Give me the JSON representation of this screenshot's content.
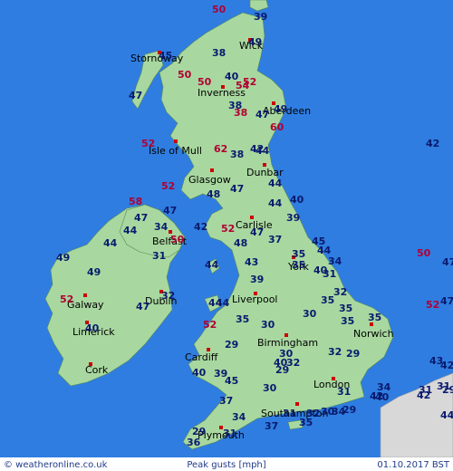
{
  "map": {
    "colors": {
      "sea": "#2f7de1",
      "land": "#a8d8a0",
      "land_stroke": "#5a8a55",
      "foreign_land": "#d8d8d8",
      "footer_bg": "#ffffff",
      "city_marker": "#cc0000",
      "normal_value": "#0a1a6e",
      "high_value": "#b00032"
    },
    "cities": [
      {
        "id": "wick",
        "label": "Wick"
      },
      {
        "id": "stornoway",
        "label": "Stornoway"
      },
      {
        "id": "inverness",
        "label": "Inverness"
      },
      {
        "id": "aberdeen",
        "label": "Aberdeen"
      },
      {
        "id": "isle-of-mull",
        "label": "Isle of Mull"
      },
      {
        "id": "dunbar",
        "label": "Dunbar"
      },
      {
        "id": "glasgow",
        "label": "Glasgow"
      },
      {
        "id": "carlisle",
        "label": "Carlisle"
      },
      {
        "id": "belfast",
        "label": "Belfast"
      },
      {
        "id": "york",
        "label": "York"
      },
      {
        "id": "dublin",
        "label": "Dublin"
      },
      {
        "id": "liverpool",
        "label": "Liverpool"
      },
      {
        "id": "galway",
        "label": "Galway"
      },
      {
        "id": "limerick",
        "label": "Limerick"
      },
      {
        "id": "birmingham",
        "label": "Birmingham"
      },
      {
        "id": "norwich",
        "label": "Norwich"
      },
      {
        "id": "cork",
        "label": "Cork"
      },
      {
        "id": "cardiff",
        "label": "Cardiff"
      },
      {
        "id": "london",
        "label": "London"
      },
      {
        "id": "southampton",
        "label": "Southampton"
      },
      {
        "id": "plymouth",
        "label": "Plymouth"
      }
    ],
    "gust_values": [
      {
        "v": "50",
        "high": true
      },
      {
        "v": "39",
        "high": false
      },
      {
        "v": "49",
        "high": false
      },
      {
        "v": "45",
        "high": false
      },
      {
        "v": "38",
        "high": false
      },
      {
        "v": "50",
        "high": true
      },
      {
        "v": "40",
        "high": false
      },
      {
        "v": "50",
        "high": true
      },
      {
        "v": "54",
        "high": true
      },
      {
        "v": "52",
        "high": true
      },
      {
        "v": "47",
        "high": false
      },
      {
        "v": "38",
        "high": false
      },
      {
        "v": "38",
        "high": true
      },
      {
        "v": "47",
        "high": false
      },
      {
        "v": "49",
        "high": false
      },
      {
        "v": "60",
        "high": true
      },
      {
        "v": "52",
        "high": true
      },
      {
        "v": "62",
        "high": true
      },
      {
        "v": "42",
        "high": false
      },
      {
        "v": "44",
        "high": false
      },
      {
        "v": "38",
        "high": false
      },
      {
        "v": "42",
        "high": false
      },
      {
        "v": "52",
        "high": true
      },
      {
        "v": "48",
        "high": false
      },
      {
        "v": "47",
        "high": false
      },
      {
        "v": "44",
        "high": false
      },
      {
        "v": "40",
        "high": false
      },
      {
        "v": "58",
        "high": true
      },
      {
        "v": "47",
        "high": false
      },
      {
        "v": "47",
        "high": false
      },
      {
        "v": "44",
        "high": false
      },
      {
        "v": "39",
        "high": false
      },
      {
        "v": "52",
        "high": true
      },
      {
        "v": "34",
        "high": false
      },
      {
        "v": "42",
        "high": false
      },
      {
        "v": "50",
        "high": true
      },
      {
        "v": "44",
        "high": false
      },
      {
        "v": "44",
        "high": false
      },
      {
        "v": "47",
        "high": false
      },
      {
        "v": "48",
        "high": false
      },
      {
        "v": "37",
        "high": false
      },
      {
        "v": "35",
        "high": false
      },
      {
        "v": "45",
        "high": false
      },
      {
        "v": "44",
        "high": false
      },
      {
        "v": "34",
        "high": false
      },
      {
        "v": "49",
        "high": false
      },
      {
        "v": "31",
        "high": false
      },
      {
        "v": "44",
        "high": false
      },
      {
        "v": "43",
        "high": false
      },
      {
        "v": "40",
        "high": false
      },
      {
        "v": "35",
        "high": false
      },
      {
        "v": "49",
        "high": false
      },
      {
        "v": "39",
        "high": false
      },
      {
        "v": "31",
        "high": false
      },
      {
        "v": "50",
        "high": true
      },
      {
        "v": "47",
        "high": false
      },
      {
        "v": "52",
        "high": true
      },
      {
        "v": "44",
        "high": false
      },
      {
        "v": "44",
        "high": false
      },
      {
        "v": "32",
        "high": false
      },
      {
        "v": "32",
        "high": false
      },
      {
        "v": "47",
        "high": false
      },
      {
        "v": "35",
        "high": false
      },
      {
        "v": "35",
        "high": false
      },
      {
        "v": "40",
        "high": false
      },
      {
        "v": "52",
        "high": true
      },
      {
        "v": "35",
        "high": false
      },
      {
        "v": "30",
        "high": false
      },
      {
        "v": "30",
        "high": false
      },
      {
        "v": "35",
        "high": false
      },
      {
        "v": "29",
        "high": false
      },
      {
        "v": "30",
        "high": false
      },
      {
        "v": "35",
        "high": false
      },
      {
        "v": "32",
        "high": false
      },
      {
        "v": "29",
        "high": false
      },
      {
        "v": "40",
        "high": false
      },
      {
        "v": "39",
        "high": false
      },
      {
        "v": "45",
        "high": false
      },
      {
        "v": "40",
        "high": false
      },
      {
        "v": "32",
        "high": false
      },
      {
        "v": "30",
        "high": false
      },
      {
        "v": "31",
        "high": false
      },
      {
        "v": "34",
        "high": false
      },
      {
        "v": "40",
        "high": false
      },
      {
        "v": "42",
        "high": false
      },
      {
        "v": "37",
        "high": false
      },
      {
        "v": "29",
        "high": false
      },
      {
        "v": "31",
        "high": false
      },
      {
        "v": "31",
        "high": false
      },
      {
        "v": "34",
        "high": false
      },
      {
        "v": "35",
        "high": false
      },
      {
        "v": "37",
        "high": false
      },
      {
        "v": "31",
        "high": false
      },
      {
        "v": "32",
        "high": false
      },
      {
        "v": "30",
        "high": false
      },
      {
        "v": "34",
        "high": false
      },
      {
        "v": "29",
        "high": false
      },
      {
        "v": "42",
        "high": false
      },
      {
        "v": "52",
        "high": true
      },
      {
        "v": "47",
        "high": false
      },
      {
        "v": "29",
        "high": false
      },
      {
        "v": "31",
        "high": false
      },
      {
        "v": "36",
        "high": false
      },
      {
        "v": "29",
        "high": false
      },
      {
        "v": "44",
        "high": false
      },
      {
        "v": "43",
        "high": false
      },
      {
        "v": "42",
        "high": false
      }
    ]
  },
  "footer": {
    "copyright": "© weatheronline.co.uk",
    "title": "Peak gusts [mph]",
    "date": "01.10.2017 BST"
  }
}
